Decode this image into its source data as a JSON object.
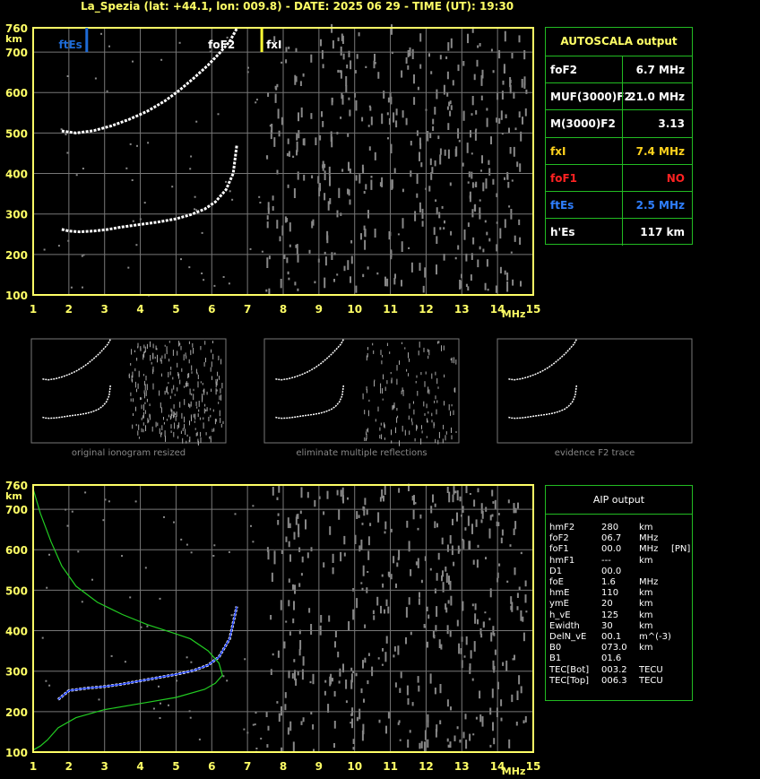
{
  "header": {
    "title": "La_Spezia (lat: +44.1, lon: 009.8) - DATE: 2025 06 29 - TIME (UT): 19:30"
  },
  "colors": {
    "axes": "#ffff66",
    "grid": "#777777",
    "trace": "#ffffff",
    "noise": "#888888",
    "box_border": "#22bb22",
    "ftEs_marker": "#1e6bd6",
    "fxI_marker": "#ffff33",
    "profile": "#22cc22",
    "fit": "#2244ff"
  },
  "main_chart": {
    "x_ticks": [
      "1",
      "2",
      "3",
      "4",
      "5",
      "6",
      "7",
      "8",
      "9",
      "10",
      "11",
      "12",
      "13",
      "14",
      "15"
    ],
    "x_unit": "MHz",
    "y_ticks": [
      "100",
      "200",
      "300",
      "400",
      "500",
      "600",
      "700",
      "760"
    ],
    "y_unit": "km",
    "markers": {
      "ftEs": "ftEs",
      "foF2": "foF2",
      "fxI": "fxI"
    }
  },
  "autoscala": {
    "title": "AUTOSCALA output",
    "rows": [
      {
        "key": "foF2",
        "value": "6.7 MHz",
        "color": "#ffffff"
      },
      {
        "key": "MUF(3000)F2",
        "value": "21.0 MHz",
        "color": "#ffffff"
      },
      {
        "key": "M(3000)F2",
        "value": "3.13",
        "color": "#ffffff"
      },
      {
        "key": "fxI",
        "value": "7.4 MHz",
        "color": "#ffd21e"
      },
      {
        "key": "foF1",
        "value": "NO",
        "color": "#ff2222"
      },
      {
        "key": "ftEs",
        "value": "2.5 MHz",
        "color": "#2f7fff"
      },
      {
        "key": "h'Es",
        "value": "117     km",
        "color": "#ffffff"
      }
    ]
  },
  "thumbnails": [
    {
      "caption": "original ionogram resized"
    },
    {
      "caption": "eliminate multiple reflections"
    },
    {
      "caption": "evidence F2 trace"
    }
  ],
  "aip": {
    "title": "AIP output",
    "rows": [
      {
        "k": "hmF2",
        "v": "280",
        "u": "km",
        "x": ""
      },
      {
        "k": "foF2",
        "v": "06.7",
        "u": "MHz",
        "x": ""
      },
      {
        "k": "foF1",
        "v": "00.0",
        "u": "MHz",
        "x": "[PN]"
      },
      {
        "k": "hmF1",
        "v": "---",
        "u": "km",
        "x": ""
      },
      {
        "k": "D1",
        "v": "00.0",
        "u": "",
        "x": ""
      },
      {
        "k": "foE",
        "v": "1.6",
        "u": "MHz",
        "x": ""
      },
      {
        "k": "hmE",
        "v": "110",
        "u": "km",
        "x": ""
      },
      {
        "k": "ymE",
        "v": "20",
        "u": "km",
        "x": ""
      },
      {
        "k": "h_vE",
        "v": "125",
        "u": "km",
        "x": ""
      },
      {
        "k": "Ewidth",
        "v": "30",
        "u": "km",
        "x": ""
      },
      {
        "k": "DelN_vE",
        "v": "00.1",
        "u": "m^(-3)",
        "x": ""
      },
      {
        "k": "B0",
        "v": "073.0",
        "u": "km",
        "x": ""
      },
      {
        "k": "B1",
        "v": "01.6",
        "u": "",
        "x": ""
      },
      {
        "k": "TEC[Bot]",
        "v": "003.2",
        "u": "TECU",
        "x": ""
      },
      {
        "k": "TEC[Top]",
        "v": "006.3",
        "u": "TECU",
        "x": ""
      }
    ]
  },
  "chart_data": [
    {
      "type": "scatter",
      "title": "",
      "xlabel": "MHz",
      "ylabel": "km",
      "xlim": [
        1,
        15
      ],
      "ylim": [
        100,
        760
      ],
      "grid": true,
      "series": [
        {
          "values_x": [
            1.8,
            2.0,
            2.3,
            2.7,
            3.1,
            3.5,
            4.0,
            4.5,
            5.0,
            5.4,
            5.8,
            6.1,
            6.4,
            6.6,
            6.7
          ],
          "values_y": [
            262,
            258,
            256,
            258,
            262,
            268,
            274,
            280,
            288,
            298,
            312,
            330,
            360,
            400,
            470
          ]
        },
        {
          "values_x": [
            1.8,
            2.2,
            2.7,
            3.2,
            3.7,
            4.2,
            4.7,
            5.1,
            5.5,
            5.9,
            6.2,
            6.5,
            6.7
          ],
          "values_y": [
            505,
            500,
            506,
            518,
            534,
            554,
            580,
            606,
            636,
            668,
            696,
            726,
            758
          ]
        }
      ],
      "markers": [
        {
          "name": "ftEs",
          "x": 2.5
        },
        {
          "name": "fxI",
          "x": 7.4
        }
      ]
    },
    {
      "type": "scatter",
      "title": "",
      "xlabel": "MHz",
      "ylabel": "km",
      "xlim": [
        1,
        15
      ],
      "ylim": [
        100,
        760
      ],
      "grid": true,
      "series": [
        {
          "values_x": [
            1.7,
            2.0,
            2.5,
            3.0,
            3.5,
            4.0,
            4.5,
            5.0,
            5.5,
            5.9,
            6.2,
            6.5,
            6.7
          ],
          "values_y": [
            230,
            252,
            258,
            262,
            268,
            276,
            284,
            292,
            302,
            315,
            335,
            380,
            460
          ]
        },
        {
          "values_x": [
            1.0,
            1.2,
            1.5,
            1.8,
            2.2,
            2.8,
            3.5,
            4.2,
            4.9,
            5.4,
            5.9,
            6.2,
            6.3,
            6.1,
            5.8,
            5.0,
            4.0,
            3.0,
            2.2,
            1.7,
            1.4,
            1.2,
            1.0
          ],
          "values_y": [
            750,
            690,
            620,
            560,
            510,
            470,
            440,
            415,
            395,
            380,
            350,
            320,
            290,
            270,
            255,
            235,
            220,
            205,
            185,
            160,
            130,
            115,
            105
          ]
        }
      ]
    }
  ]
}
